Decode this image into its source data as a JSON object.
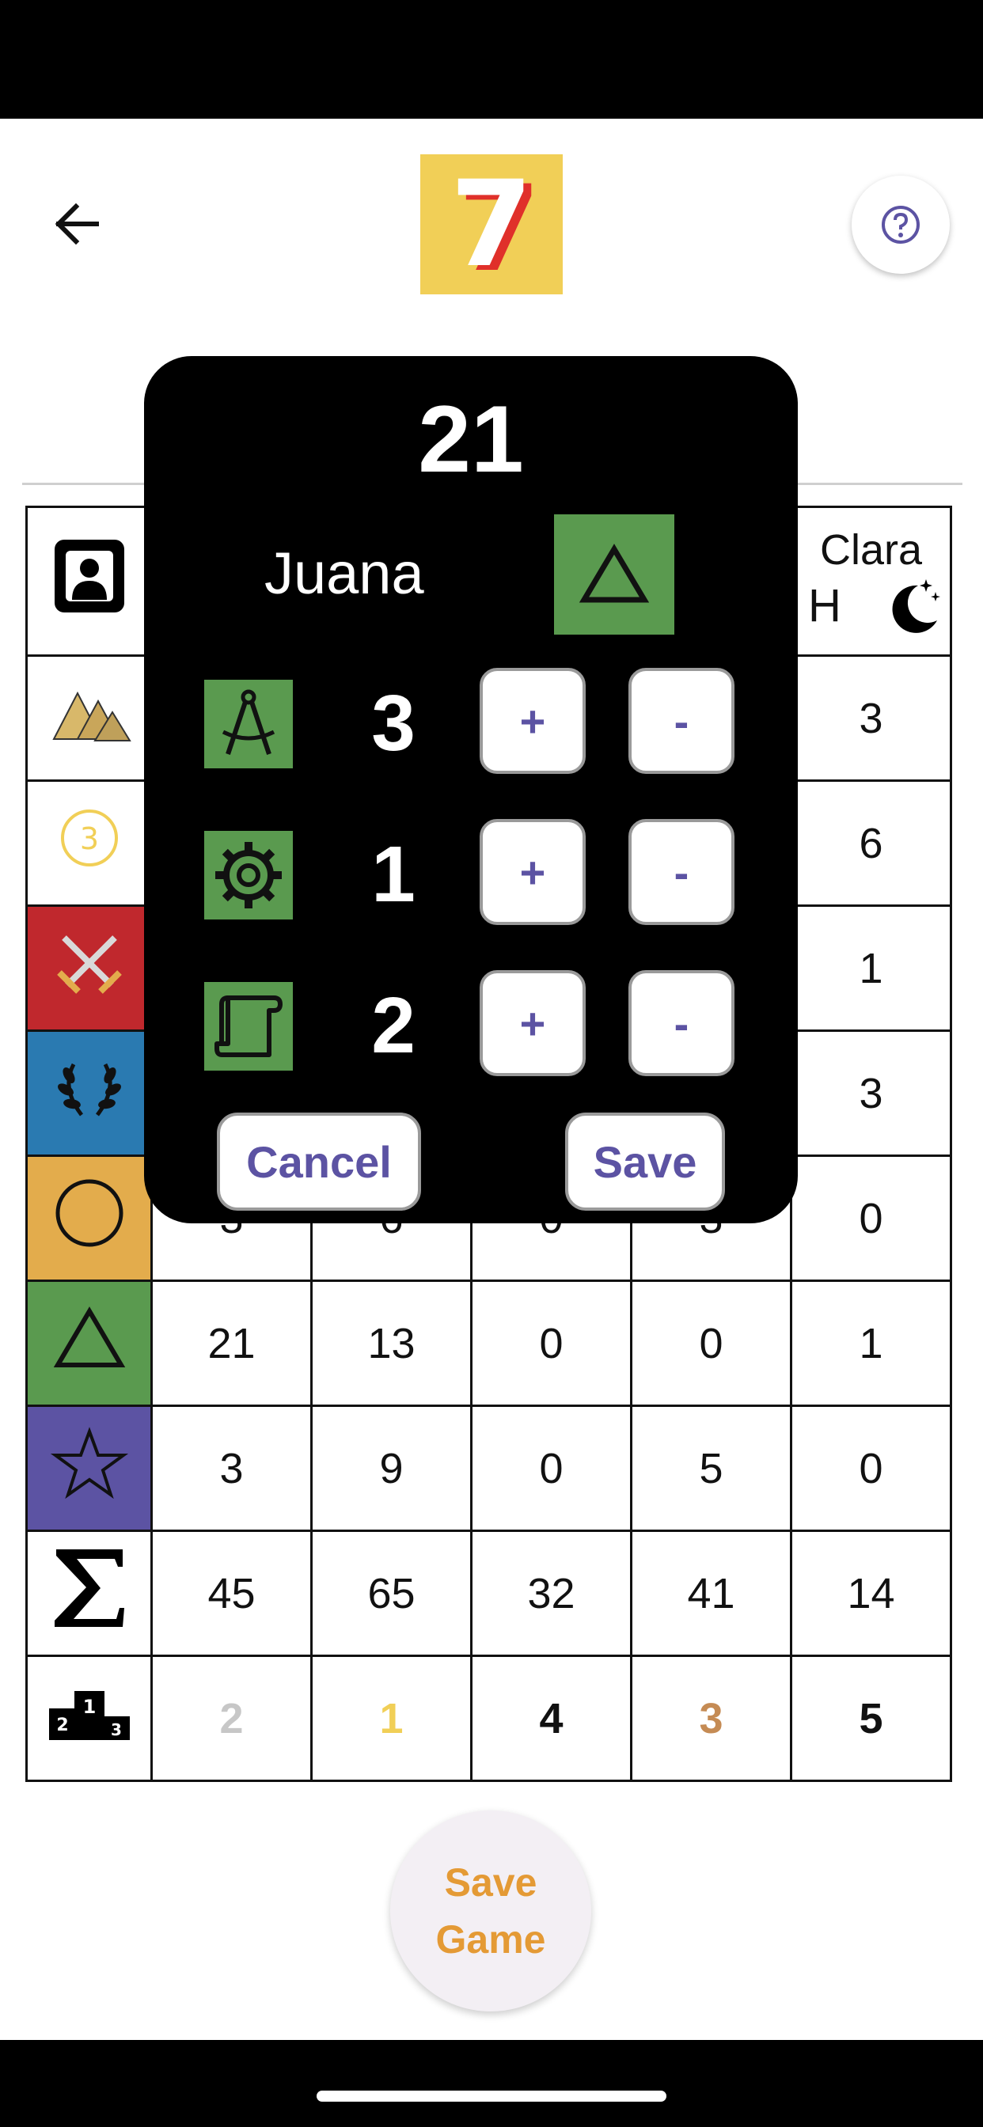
{
  "header": {
    "logo_text": "7",
    "back_icon": "arrow-left-icon",
    "help_icon": "question-circle-icon"
  },
  "scoreboard": {
    "player_headers": [
      {
        "name": "Clara",
        "side": "H",
        "icon": "moon-stars-icon"
      }
    ],
    "categories": [
      {
        "icon": "pyramids-icon",
        "values": [
          "",
          "",
          "",
          "",
          "3"
        ]
      },
      {
        "icon": "coin-three-icon",
        "values": [
          "",
          "",
          "",
          "",
          "6"
        ]
      },
      {
        "icon": "crossed-swords-icon",
        "values": [
          "",
          "",
          "",
          "",
          "1"
        ]
      },
      {
        "icon": "laurel-wreath-icon",
        "values": [
          "",
          "",
          "",
          "",
          "3"
        ]
      },
      {
        "icon": "circle-icon",
        "values": [
          "3",
          "6",
          "0",
          "3",
          "0"
        ]
      },
      {
        "icon": "triangle-icon",
        "values": [
          "21",
          "13",
          "0",
          "0",
          "1"
        ]
      },
      {
        "icon": "star-icon",
        "values": [
          "3",
          "9",
          "0",
          "5",
          "0"
        ]
      }
    ],
    "totals": {
      "icon": "sigma-icon",
      "values": [
        "45",
        "65",
        "32",
        "41",
        "14"
      ]
    },
    "ranks": {
      "icon": "podium-icon",
      "values": [
        "2",
        "1",
        "4",
        "3",
        "5"
      ]
    }
  },
  "colors": {
    "gold": "#f1cf57",
    "silver": "#c7c7c7",
    "bronze": "#c58b54",
    "accent_purple": "#5c53a3",
    "science_green": "#5a9a4f",
    "save_orange": "#e49a35"
  },
  "modal": {
    "score": "21",
    "player_name": "Juana",
    "category_icon": "triangle-icon",
    "rows": [
      {
        "icon": "compass-icon",
        "value": "3",
        "plus": "+",
        "minus": "-"
      },
      {
        "icon": "gear-icon",
        "value": "1",
        "plus": "+",
        "minus": "-"
      },
      {
        "icon": "scroll-icon",
        "value": "2",
        "plus": "+",
        "minus": "-"
      }
    ],
    "cancel_label": "Cancel",
    "save_label": "Save"
  },
  "fab": {
    "label_line1": "Save",
    "label_line2": "Game"
  }
}
